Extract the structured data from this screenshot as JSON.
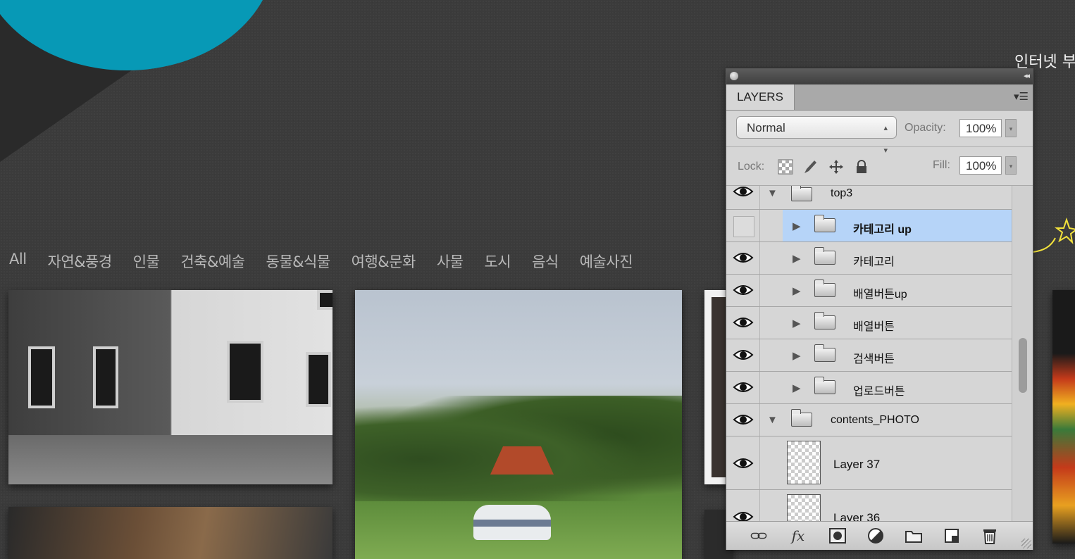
{
  "top_right_text": "인터넷 부",
  "categories": [
    "All",
    "자연&풍경",
    "인물",
    "건축&예술",
    "동물&식물",
    "여행&문화",
    "사물",
    "도시",
    "음식",
    "예술사진"
  ],
  "colors": {
    "accent_circle": "#0799b6",
    "background": "#3b3b3b",
    "selected_layer": "#b6d4f8"
  },
  "layers_panel": {
    "tab_label": "LAYERS",
    "blend_mode": "Normal",
    "opacity_label": "Opacity:",
    "opacity_value": "100%",
    "lock_label": "Lock:",
    "fill_label": "Fill:",
    "fill_value": "100%",
    "layers": [
      {
        "name": "top3",
        "type": "group",
        "expanded": true,
        "visible": true
      },
      {
        "name": "카테고리 up",
        "type": "group",
        "expanded": false,
        "visible": false,
        "selected": true
      },
      {
        "name": "카테고리",
        "type": "group",
        "expanded": false,
        "visible": true
      },
      {
        "name": "배열버튼up",
        "type": "group",
        "expanded": false,
        "visible": true
      },
      {
        "name": "배열버튼",
        "type": "group",
        "expanded": false,
        "visible": true
      },
      {
        "name": "검색버튼",
        "type": "group",
        "expanded": false,
        "visible": true
      },
      {
        "name": "업로드버튼",
        "type": "group",
        "expanded": false,
        "visible": true
      },
      {
        "name": "contents_PHOTO",
        "type": "group",
        "expanded": true,
        "visible": true
      },
      {
        "name": "Layer 37",
        "type": "layer",
        "visible": true
      },
      {
        "name": "Layer 36",
        "type": "layer",
        "visible": true
      }
    ],
    "bottom_icons": [
      "link-icon",
      "fx-icon",
      "mask-icon",
      "adjustment-icon",
      "new-group-icon",
      "new-layer-icon",
      "trash-icon"
    ]
  }
}
